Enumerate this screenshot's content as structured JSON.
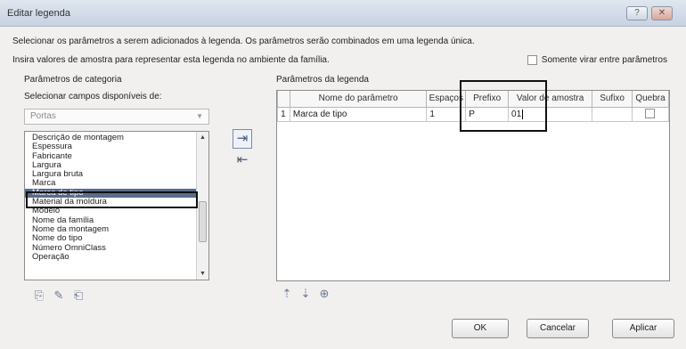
{
  "window": {
    "title": "Editar legenda",
    "help_label": "?",
    "close_label": "✕"
  },
  "description": {
    "line1": "Selecionar os parâmetros a serem adicionados à legenda. Os parâmetros serão combinados em uma legenda única.",
    "line2": "Insira valores de amostra para representar esta legenda no ambiente da família."
  },
  "only_rotate": {
    "label": "Somente virar entre parâmetros",
    "checked": false
  },
  "category_panel": {
    "heading": "Parâmetros de categoria",
    "select_label": "Selecionar campos disponíveis de:",
    "combo_value": "Portas",
    "items": [
      "Descrição de montagem",
      "Espessura",
      "Fabricante",
      "Largura",
      "Largura bruta",
      "Marca",
      "Marca de tipo",
      "Material da moldura",
      "Modelo",
      "Nome da família",
      "Nome da montagem",
      "Nome do tipo",
      "Número OmniClass",
      "Operação"
    ],
    "selected_index": 6
  },
  "legend_panel": {
    "heading": "Parâmetros da legenda",
    "columns": [
      "Nome do parâmetro",
      "Espaços",
      "Prefixo",
      "Valor de amostra",
      "Sufixo",
      "Quebra"
    ],
    "rows": [
      {
        "num": "1",
        "name": "Marca de tipo",
        "spaces": "1",
        "prefix": "P",
        "sample": "01",
        "suffix": "",
        "wrap": false
      }
    ]
  },
  "icons": {
    "add_param": "add-parameter-icon",
    "remove_param": "remove-parameter-icon",
    "move_up": "move-up-icon",
    "move_down": "move-down-icon",
    "increase_spaces": "increase-spaces-icon",
    "new_param": "new-parameter-icon",
    "edit_param": "edit-parameter-icon",
    "add_value": "add-value-icon"
  },
  "buttons": {
    "ok": "OK",
    "cancel": "Cancelar",
    "apply": "Aplicar"
  }
}
